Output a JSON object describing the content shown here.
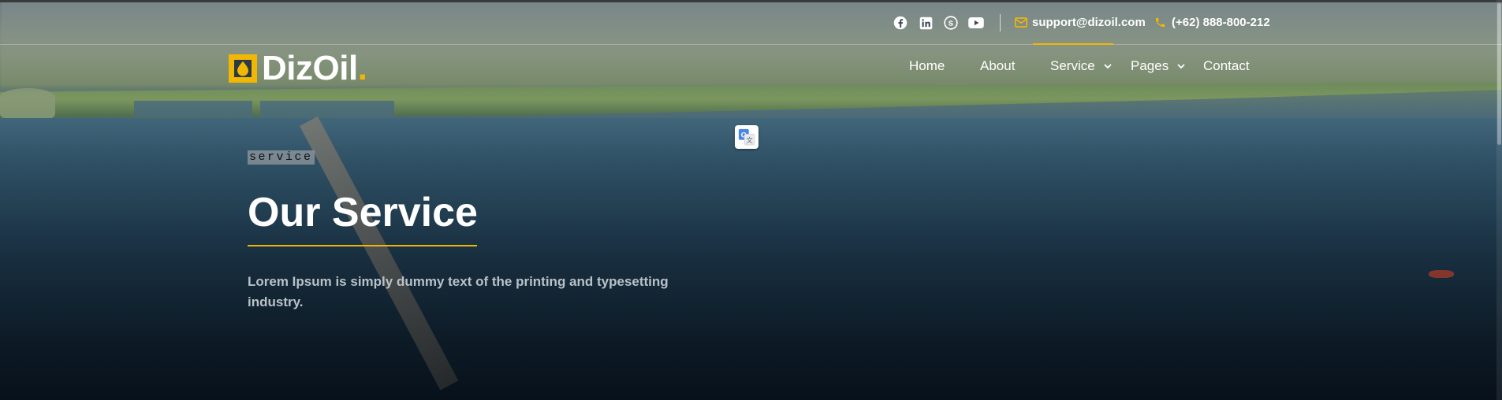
{
  "colors": {
    "accent": "#f2b705",
    "text": "#ffffff",
    "muted": "#b9c2c8"
  },
  "topbar": {
    "social": [
      {
        "name": "facebook-icon"
      },
      {
        "name": "linkedin-icon"
      },
      {
        "name": "skype-icon"
      },
      {
        "name": "youtube-icon"
      }
    ],
    "email": "support@dizoil.com",
    "phone": "(+62) 888-800-212"
  },
  "logo": {
    "text": "DizOil",
    "dot": "."
  },
  "nav": {
    "items": [
      {
        "label": "Home",
        "has_dropdown": false
      },
      {
        "label": "About",
        "has_dropdown": false
      },
      {
        "label": "Service",
        "has_dropdown": true,
        "active": true
      },
      {
        "label": "Pages",
        "has_dropdown": true
      },
      {
        "label": "Contact",
        "has_dropdown": false
      }
    ]
  },
  "hero": {
    "eyebrow": "service",
    "title": "Our Service",
    "description": "Lorem Ipsum is simply dummy text of the printing and typesetting industry."
  },
  "translate_widget": {
    "icon": "google-translate-icon"
  }
}
